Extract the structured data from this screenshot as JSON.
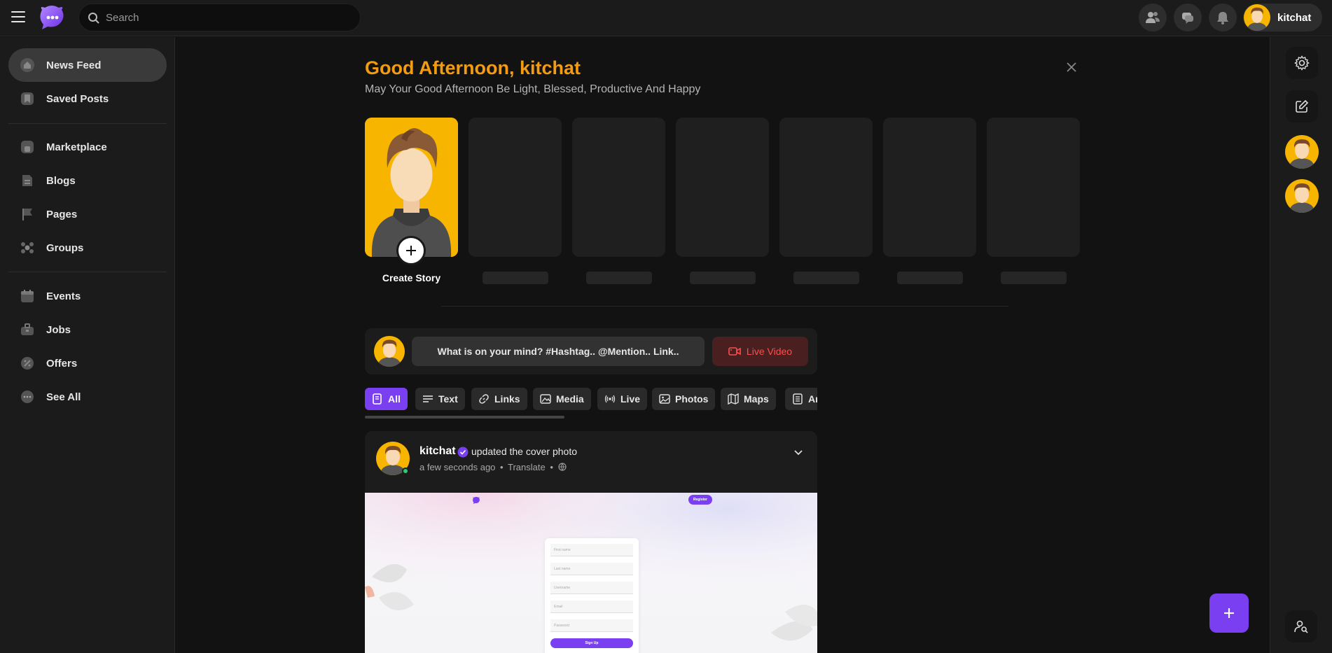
{
  "header": {
    "search_placeholder": "Search",
    "user_name": "kitchat"
  },
  "sidebar": {
    "items": [
      {
        "label": "News Feed",
        "icon": "home-icon",
        "active": true
      },
      {
        "label": "Saved Posts",
        "icon": "bookmark-icon"
      },
      {
        "label": "Marketplace",
        "icon": "store-icon"
      },
      {
        "label": "Blogs",
        "icon": "blog-icon"
      },
      {
        "label": "Pages",
        "icon": "flag-icon"
      },
      {
        "label": "Groups",
        "icon": "group-icon"
      },
      {
        "label": "Events",
        "icon": "calendar-icon"
      },
      {
        "label": "Jobs",
        "icon": "briefcase-icon"
      },
      {
        "label": "Offers",
        "icon": "offer-icon"
      },
      {
        "label": "See All",
        "icon": "more-icon"
      }
    ]
  },
  "greeting": {
    "title": "Good Afternoon, kitchat",
    "subtitle": "May Your Good Afternoon Be Light, Blessed, Productive And Happy"
  },
  "stories": {
    "create_label": "Create Story"
  },
  "composer": {
    "placeholder": "What is on your mind? #Hashtag.. @Mention.. Link..",
    "live_label": "Live Video"
  },
  "filters": [
    "All",
    "Text",
    "Links",
    "Media",
    "Live",
    "Photos",
    "Maps",
    "Ar"
  ],
  "post": {
    "author": "kitchat",
    "action": "updated the cover photo",
    "time": "a few seconds ago",
    "translate": "Translate",
    "separator": "•",
    "form_fields": [
      "First name",
      "Last name",
      "Username",
      "Email",
      "Password"
    ],
    "form_button": "Sign Up",
    "register_label": "Register"
  },
  "colors": {
    "accent": "#7b3ff2",
    "greeting": "#f39c12",
    "live": "#ff4d4d"
  }
}
